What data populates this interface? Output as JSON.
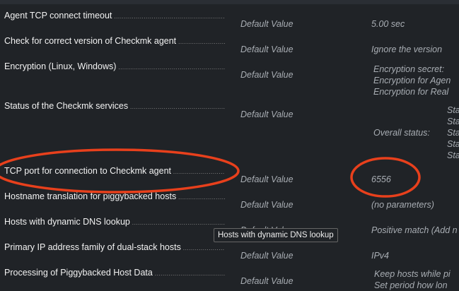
{
  "rows": [
    {
      "label": "Agent TCP connect timeout",
      "source": "Default Value",
      "value": "5.00 sec"
    },
    {
      "label": "Check for correct version of Checkmk agent",
      "source": "Default Value",
      "value": "Ignore the version"
    },
    {
      "label": "Encryption (Linux, Windows)",
      "source": "Default Value",
      "value_lines": [
        "Encryption secret:",
        "Encryption for Agen",
        "Encryption for Real"
      ]
    },
    {
      "label": "Status of the Checkmk services",
      "source": "Default Value",
      "value_lines": [
        "Sta",
        "Sta",
        "Sta",
        "Sta",
        "Sta"
      ],
      "overall_label": "Overall status:"
    },
    {
      "label": "TCP port for connection to Checkmk agent",
      "source": "Default Value",
      "value": "6556"
    },
    {
      "label": "Hostname translation for piggybacked hosts",
      "source": "Default Value",
      "value": "(no parameters)"
    },
    {
      "label": "Hosts with dynamic DNS lookup",
      "source": "Default Value",
      "value": "Positive match (Add n"
    },
    {
      "label": "Primary IP address family of dual-stack hosts",
      "source": "Default Value",
      "value": "IPv4"
    },
    {
      "label": "Processing of Piggybacked Host Data",
      "source": "Default Value",
      "value_lines": [
        "Keep hosts while pi",
        "Set period how lon"
      ]
    }
  ],
  "tooltip": "Hosts with dynamic DNS lookup",
  "annotation_color": "#e8401c"
}
